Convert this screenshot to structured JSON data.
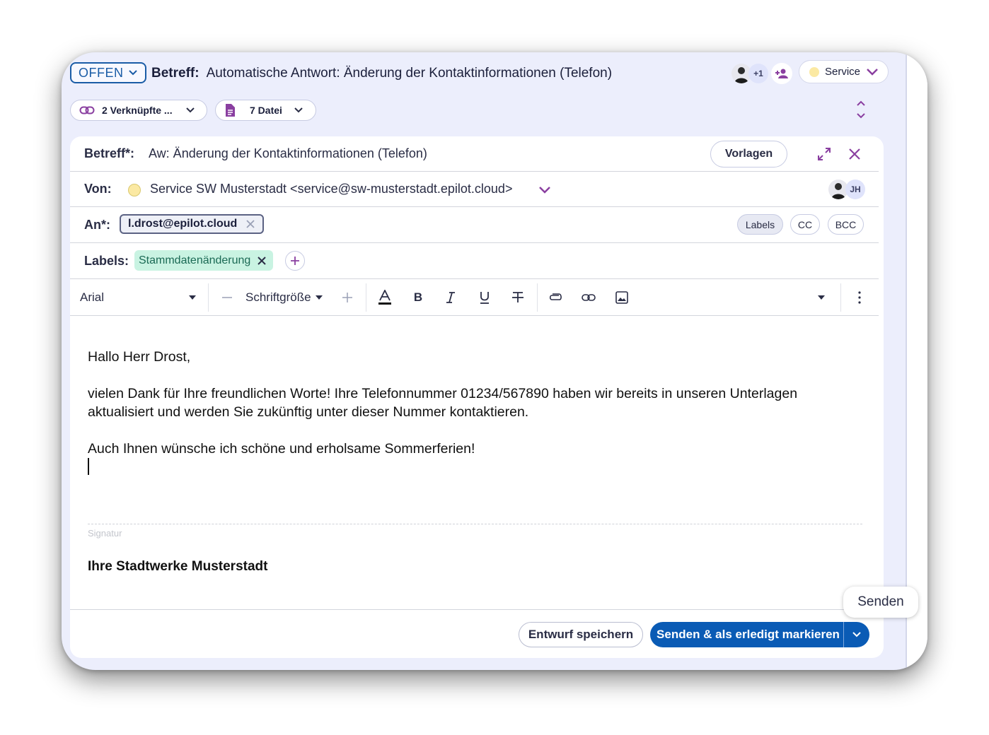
{
  "header": {
    "status": "OFFEN",
    "subject_label": "Betreff:",
    "subject": "Automatische Antwort: Änderung der Kontaktinformationen (Telefon)",
    "participants_more": "+1",
    "team": "Service"
  },
  "links": {
    "linked_label": "2 Verknüpfte ...",
    "files_label": "7 Datei"
  },
  "compose": {
    "subject_label": "Betreff*:",
    "subject_value": "Aw: Änderung der Kontaktinformationen (Telefon)",
    "templates_button": "Vorlagen",
    "from_label": "Von:",
    "from_value": "Service SW Musterstadt <service@sw-musterstadt.epilot.cloud>",
    "from_initials": "JH",
    "to_label": "An*:",
    "to_recipient": "l.drost@epilot.cloud",
    "labels_button": "Labels",
    "cc_button": "CC",
    "bcc_button": "BCC",
    "labels_label": "Labels:",
    "label_tag": "Stammdatenänderung"
  },
  "toolbar": {
    "font_family": "Arial",
    "font_size": "Schriftgröße",
    "bold": "B",
    "italic": "I",
    "underline": "U"
  },
  "body": {
    "greeting": "Hallo Herr Drost,",
    "para1_line1": "vielen Dank für Ihre freundlichen Worte! Ihre Telefonnummer 01234/567890 haben wir bereits in unseren Unterlagen",
    "para1_line2": "aktualisiert und werden Sie zukünftig unter dieser Nummer kontaktieren.",
    "para2": "Auch Ihnen wünsche ich schöne und erholsame Sommerferien!",
    "signature_label": "Signatur",
    "signature": "Ihre Stadtwerke Musterstadt"
  },
  "footer": {
    "draft_button": "Entwurf speichern",
    "send_button": "Senden & als erledigt markieren",
    "tooltip": "Senden"
  },
  "colors": {
    "accent_purple": "#8a3fa0",
    "primary_blue": "#0a5bb5",
    "window_bg": "#eceefc"
  },
  "icons": [
    "chevron-down-icon",
    "add-user-icon",
    "link-icon",
    "file-icon",
    "expand-collapse-icon",
    "fullscreen-icon",
    "close-icon",
    "plus-icon",
    "text-color-icon",
    "strikethrough-icon",
    "attachment-icon",
    "image-icon",
    "more-vertical-icon"
  ]
}
